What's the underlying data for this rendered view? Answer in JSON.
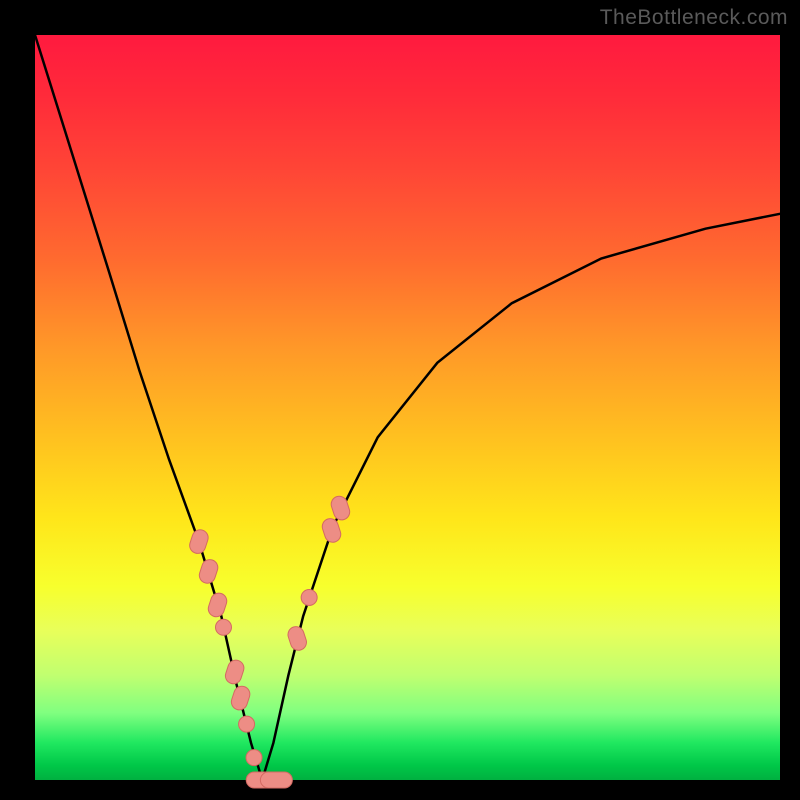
{
  "watermark": "TheBottleneck.com",
  "colors": {
    "background": "#000000",
    "curve": "#000000",
    "marker_fill": "#ed8d85",
    "marker_stroke": "#d46a62",
    "gradient_top": "#ff1a3f",
    "gradient_bottom": "#00b040"
  },
  "chart_data": {
    "type": "line",
    "title": "",
    "xlabel": "",
    "ylabel": "",
    "xlim": [
      0,
      100
    ],
    "ylim": [
      0,
      100
    ],
    "description": "V-shaped bottleneck curve over a red-to-green vertical gradient. Y encodes bottleneck severity (top = 100% = red/bad, bottom = 0% = green/good). Minimum of the V is the balanced point.",
    "series": [
      {
        "name": "bottleneck-curve",
        "x": [
          0,
          5,
          10,
          14,
          18,
          22,
          25,
          27,
          29,
          30.5,
          32,
          34,
          36,
          40,
          46,
          54,
          64,
          76,
          90,
          100
        ],
        "y": [
          100,
          84,
          68,
          55,
          43,
          32,
          22,
          13,
          5,
          0,
          5,
          14,
          22,
          34,
          46,
          56,
          64,
          70,
          74,
          76
        ]
      }
    ],
    "markers": [
      {
        "series": "bottleneck-curve",
        "x": 22.0,
        "y": 32.0,
        "shape": "pill"
      },
      {
        "series": "bottleneck-curve",
        "x": 23.3,
        "y": 28.0,
        "shape": "pill"
      },
      {
        "series": "bottleneck-curve",
        "x": 24.5,
        "y": 23.5,
        "shape": "pill"
      },
      {
        "series": "bottleneck-curve",
        "x": 25.3,
        "y": 20.5,
        "shape": "dot"
      },
      {
        "series": "bottleneck-curve",
        "x": 26.8,
        "y": 14.5,
        "shape": "pill"
      },
      {
        "series": "bottleneck-curve",
        "x": 27.6,
        "y": 11.0,
        "shape": "pill"
      },
      {
        "series": "bottleneck-curve",
        "x": 28.4,
        "y": 7.5,
        "shape": "dot"
      },
      {
        "series": "bottleneck-curve",
        "x": 29.4,
        "y": 3.0,
        "shape": "dot"
      },
      {
        "series": "bottleneck-curve",
        "x": 30.5,
        "y": 0.0,
        "shape": "pill-wide"
      },
      {
        "series": "bottleneck-curve",
        "x": 32.4,
        "y": 0.0,
        "shape": "pill-wide"
      },
      {
        "series": "bottleneck-curve",
        "x": 35.2,
        "y": 19.0,
        "shape": "pill"
      },
      {
        "series": "bottleneck-curve",
        "x": 36.8,
        "y": 24.5,
        "shape": "dot"
      },
      {
        "series": "bottleneck-curve",
        "x": 39.8,
        "y": 33.5,
        "shape": "pill"
      },
      {
        "series": "bottleneck-curve",
        "x": 41.0,
        "y": 36.5,
        "shape": "pill"
      }
    ]
  }
}
